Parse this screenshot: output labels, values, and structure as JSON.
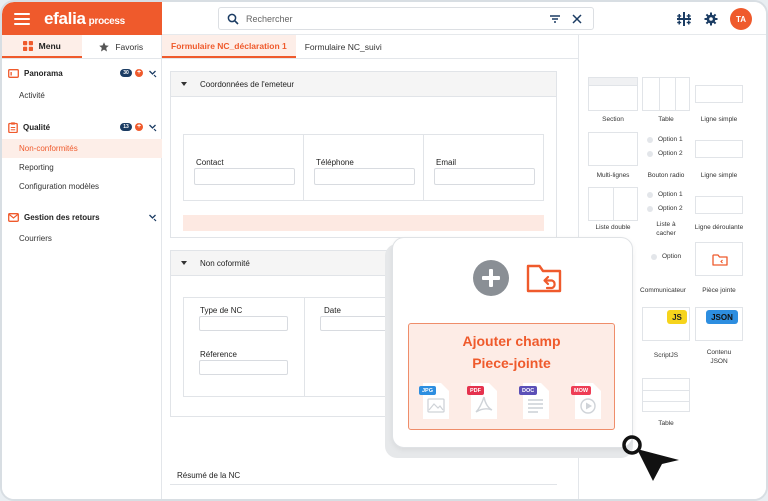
{
  "header": {
    "logo_main": "efalia",
    "logo_sub": "process",
    "search_placeholder": "Rechercher",
    "user_initials": "TA"
  },
  "sidebar": {
    "tab_menu": "Menu",
    "tab_favoris": "Favoris",
    "sections": [
      {
        "title": "Panorama",
        "badge": "30",
        "items": [
          "Activité"
        ]
      },
      {
        "title": "Qualité",
        "badge": "13",
        "items": [
          "Non-conformités",
          "Reporting",
          "Configuration modèles"
        ]
      },
      {
        "title": "Gestion des retours",
        "items": [
          "Courriers"
        ]
      }
    ]
  },
  "form_tabs": [
    "Formulaire NC_déclaration 1",
    "Formulaire  NC_suivi"
  ],
  "form": {
    "panel1_title": "Coordonnées de l'emeteur",
    "contact_label": "Contact",
    "telephone_label": "Téléphone",
    "email_label": "Email",
    "panel2_title": "Non coformité",
    "type_label": "Type de NC",
    "date_label": "Date",
    "reference_label": "Réference",
    "resume_label": "Résumé de la NC"
  },
  "components": {
    "section": "Section",
    "table": "Table",
    "ligne_simple": "Ligne simple",
    "multi_lignes": "Multi-lignes",
    "bouton_radio": "Bouton radio",
    "ligne_simple_2": "Ligne simple",
    "option1": "Option 1",
    "option2": "Option 2",
    "option": "Option",
    "liste_double": "Liste double",
    "liste_a_cacher_1": "Liste à",
    "liste_a_cacher_2": "cacher",
    "ligne_deroulante": "Ligne déroulante",
    "communicateur": "Communicateur",
    "piece_jointe": "Pièce jointe",
    "js_chip": "JS",
    "json_chip": "JSON",
    "scriptjs": "ScriptJS",
    "contenu_1": "Contenu",
    "contenu_2": "JSON",
    "table_2": "Table"
  },
  "popup": {
    "title_line1": "Ajouter champ",
    "title_line2": "Piece-jointe",
    "file_types": [
      "JPG",
      "PDF",
      "DOC",
      "MOW"
    ]
  },
  "colors": {
    "brand": "#ef5a2c",
    "navy": "#1b3c63",
    "jpg": "#2d8ee0",
    "pdf": "#e5324e",
    "doc": "#5b4fb7",
    "mow": "#ee3d55",
    "js_chip": "#f6d41c",
    "json_chip": "#2d8ee0"
  }
}
